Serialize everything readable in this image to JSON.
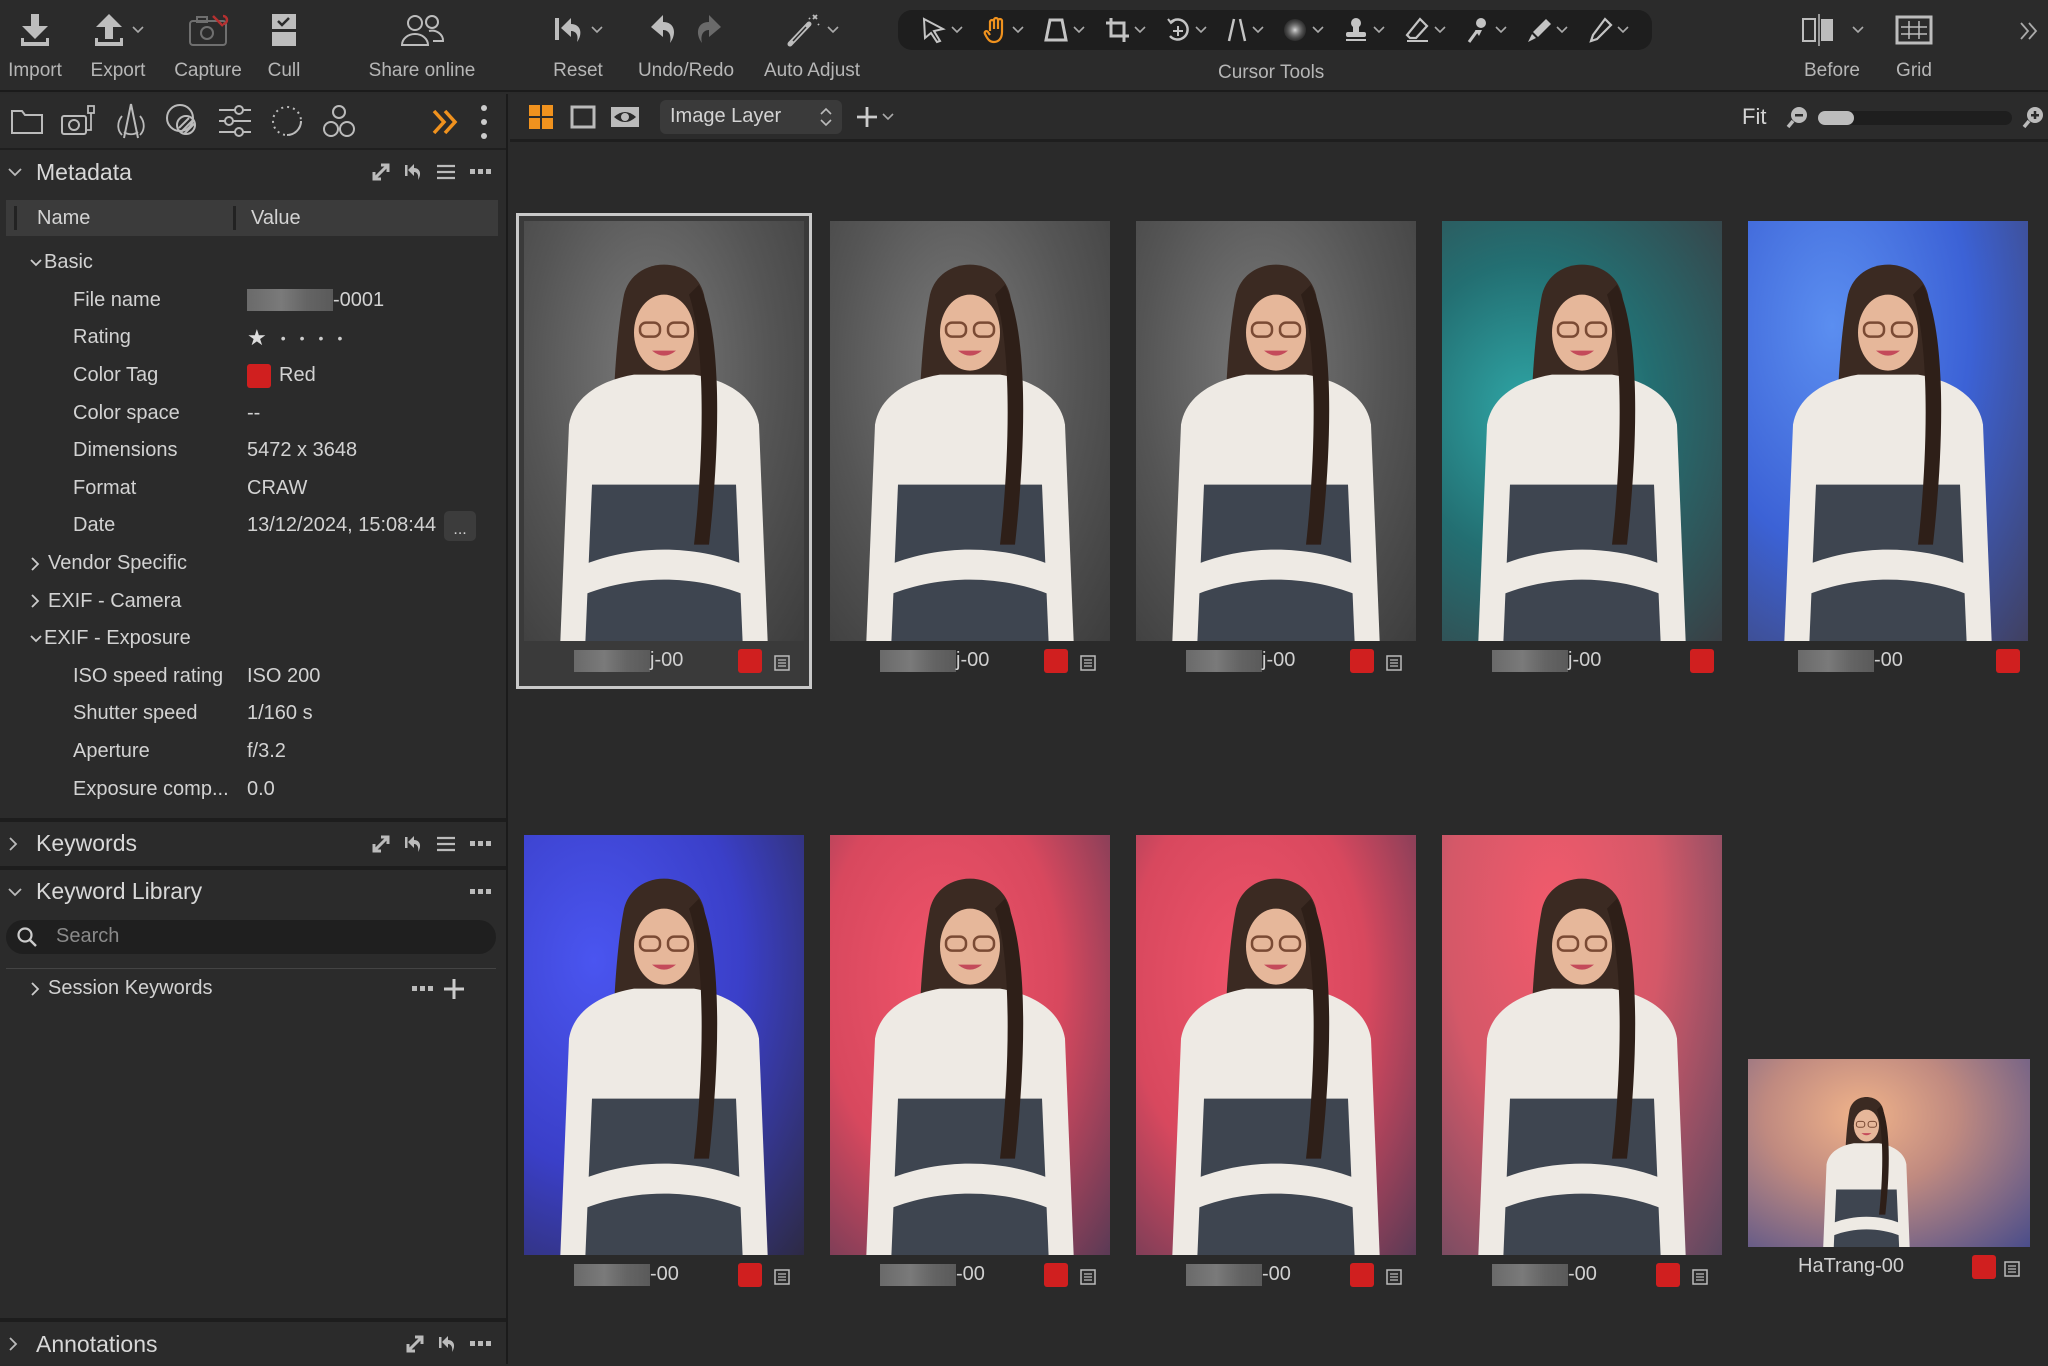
{
  "toolbar": {
    "import": "Import",
    "export": "Export",
    "capture": "Capture",
    "cull": "Cull",
    "share_online": "Share online",
    "reset": "Reset",
    "undo_redo": "Undo/Redo",
    "auto_adjust": "Auto Adjust",
    "cursor_tools": "Cursor Tools",
    "before": "Before",
    "grid": "Grid",
    "active_cursor_tool": "pan-hand"
  },
  "tool_tabs": [
    "library",
    "capture",
    "lens",
    "color",
    "adjustments",
    "details",
    "styles"
  ],
  "viewer_bar": {
    "layer_select": "Image Layer",
    "zoom_label": "Fit",
    "zoom_slider_value": 0.05
  },
  "metadata": {
    "title": "Metadata",
    "col_name": "Name",
    "col_value": "Value",
    "basic_group": "Basic",
    "rows": [
      {
        "name": "File name",
        "value": "-0001",
        "redacted": true
      },
      {
        "name": "Rating",
        "value": "1",
        "stars": 1,
        "max": 5
      },
      {
        "name": "Color Tag",
        "value": "Red",
        "color": "#d01f1f"
      },
      {
        "name": "Color space",
        "value": "--"
      },
      {
        "name": "Dimensions",
        "value": "5472 x 3648"
      },
      {
        "name": "Format",
        "value": "CRAW"
      },
      {
        "name": "Date",
        "value": "13/12/2024, 15:08:44",
        "more_button": "..."
      }
    ],
    "groups_collapsed": [
      "Vendor Specific",
      "EXIF - Camera"
    ],
    "exposure_group": "EXIF - Exposure",
    "exposure_rows": [
      {
        "name": "ISO speed rating",
        "value": "ISO 200"
      },
      {
        "name": "Shutter speed",
        "value": "1/160 s"
      },
      {
        "name": "Aperture",
        "value": "f/3.2"
      },
      {
        "name": "Exposure comp...",
        "value": "0.0"
      }
    ]
  },
  "keywords": {
    "title": "Keywords"
  },
  "keyword_library": {
    "title": "Keyword Library",
    "search_placeholder": "Search",
    "session_keywords": "Session Keywords"
  },
  "annotations": {
    "title": "Annotations"
  },
  "accent_color": "#f0921e",
  "tag_color": "#d01f1f",
  "thumbnails": [
    {
      "caption_suffix": "j-00",
      "redacted": true,
      "bg": "gray",
      "selected": true,
      "has_note": true
    },
    {
      "caption_suffix": "j-00",
      "redacted": true,
      "bg": "gray",
      "selected": false,
      "has_note": true
    },
    {
      "caption_suffix": "j-00",
      "redacted": true,
      "bg": "gray",
      "selected": false,
      "has_note": true
    },
    {
      "caption_suffix": "j-00",
      "redacted": true,
      "bg": "teal",
      "selected": false,
      "has_note": false
    },
    {
      "caption_suffix": "-00",
      "redacted": true,
      "bg": "blue",
      "selected": false,
      "has_note": false
    },
    {
      "caption_suffix": "-00",
      "redacted": true,
      "bg": "violet",
      "selected": false,
      "has_note": true
    },
    {
      "caption_suffix": "-00",
      "redacted": true,
      "bg": "red",
      "selected": false,
      "has_note": true
    },
    {
      "caption_suffix": "-00",
      "redacted": true,
      "bg": "red",
      "selected": false,
      "has_note": true
    },
    {
      "caption_suffix": "-00",
      "redacted": true,
      "bg": "pink",
      "selected": false,
      "has_note": true
    },
    {
      "caption_suffix": "HaTrang-00",
      "redacted": false,
      "bg": "peach",
      "selected": false,
      "has_note": true
    }
  ]
}
